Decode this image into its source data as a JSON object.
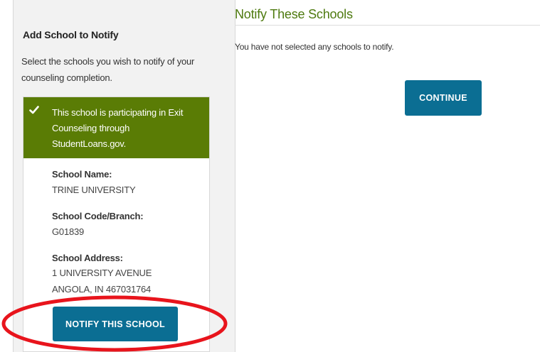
{
  "left_panel": {
    "title": "Add School to Notify",
    "description": "Select the schools you wish to notify of your counseling completion."
  },
  "school_card": {
    "banner_text": "This school is participating in Exit Counseling through StudentLoans.gov.",
    "check_icon": "checkmark-icon",
    "school_name_label": "School Name:",
    "school_name": "TRINE UNIVERSITY",
    "school_code_label": "School Code/Branch:",
    "school_code": "G01839",
    "school_address_label": "School Address:",
    "address_line1": "1 UNIVERSITY AVENUE",
    "address_line2": "ANGOLA, IN 467031764",
    "notify_button": "NOTIFY THIS SCHOOL"
  },
  "right_panel": {
    "heading": "Notify These Schools",
    "empty_message": "You have not selected any schools to notify.",
    "continue_button": "CONTINUE"
  },
  "colors": {
    "brand_green": "#5a7c05",
    "heading_green": "#4e7a0f",
    "button_blue": "#0b6e93",
    "annotation_red": "#e8141c"
  }
}
